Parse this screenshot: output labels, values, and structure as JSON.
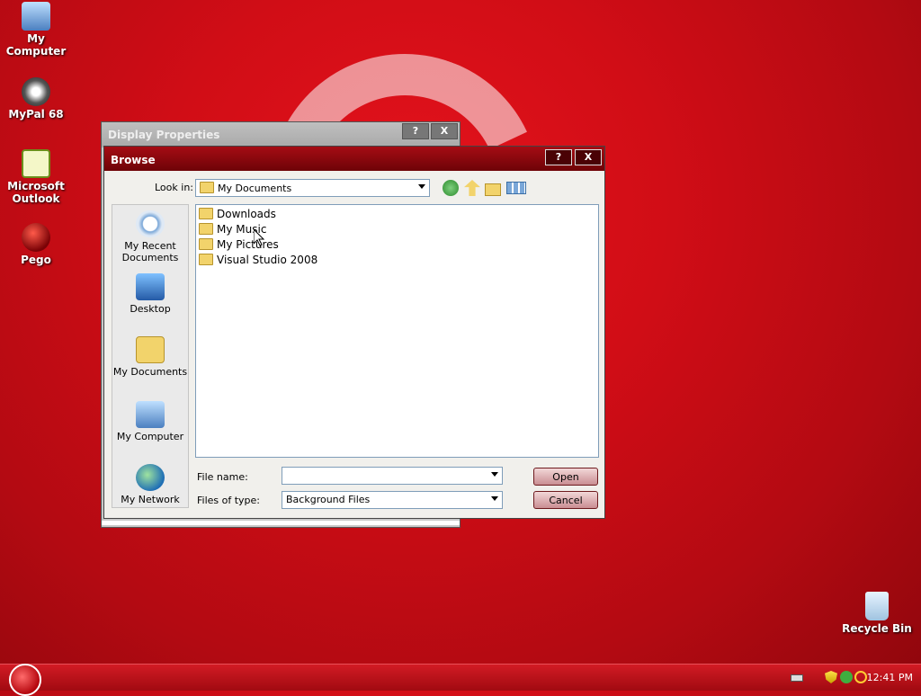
{
  "desktop": {
    "icons": [
      {
        "label": "My Computer"
      },
      {
        "label": "MyPal 68"
      },
      {
        "label": "Microsoft Outlook"
      },
      {
        "label": "Pego"
      },
      {
        "label": "Recycle Bin"
      }
    ]
  },
  "display_properties": {
    "title": "Display Properties",
    "help_label": "?",
    "close_label": "X"
  },
  "browse_dialog": {
    "title": "Browse",
    "help_label": "?",
    "close_label": "X",
    "look_in_label": "Look in:",
    "look_in_value": "My Documents",
    "places": [
      {
        "label": "My Recent Documents"
      },
      {
        "label": "Desktop"
      },
      {
        "label": "My Documents"
      },
      {
        "label": "My Computer"
      },
      {
        "label": "My Network"
      }
    ],
    "files": [
      {
        "name": "Downloads"
      },
      {
        "name": "My Music"
      },
      {
        "name": "My Pictures"
      },
      {
        "name": "Visual Studio 2008"
      }
    ],
    "file_name_label": "File name:",
    "file_name_value": "",
    "files_of_type_label": "Files of type:",
    "files_of_type_value": "Background Files",
    "open_label": "Open",
    "cancel_label": "Cancel"
  },
  "taskbar": {
    "clock": "12:41 PM"
  },
  "colors": {
    "desktop_red": "#d10d16",
    "titlebar_red": "#8a070d"
  }
}
